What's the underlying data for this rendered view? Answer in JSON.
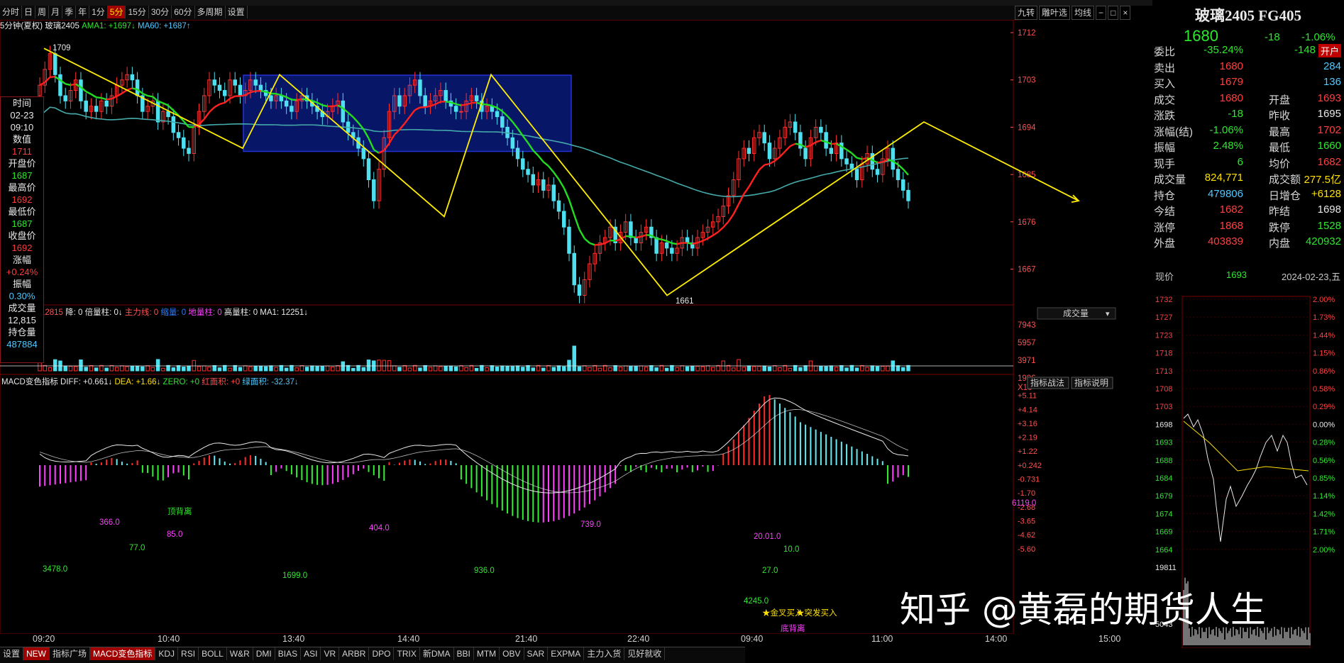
{
  "toolbar": {
    "periods": [
      "分时",
      "日",
      "周",
      "月",
      "季",
      "年",
      "1分",
      "5分",
      "15分",
      "30分",
      "60分",
      "多周期",
      "设置"
    ],
    "active_period": "5分",
    "right_buttons": [
      "九转",
      "雕叶选",
      "均线"
    ]
  },
  "chart_header": {
    "period": "5分钟(夏权)",
    "symbol": "玻璃2405",
    "ama1": "AMA1: +1697↓",
    "ma60": "MA60: +1687↑"
  },
  "cursor_box": {
    "items": [
      {
        "label": "时间",
        "value": "02-23"
      },
      {
        "label": "",
        "value": "09:10"
      },
      {
        "label": "数值",
        "value": "1711"
      },
      {
        "label": "开盘价",
        "value": "1687"
      },
      {
        "label": "最高价",
        "value": "1692"
      },
      {
        "label": "最低价",
        "value": "1687"
      },
      {
        "label": "收盘价",
        "value": "1692"
      },
      {
        "label": "涨幅",
        "value": "+0.24%"
      },
      {
        "label": "振幅",
        "value": "0.30%"
      },
      {
        "label": "成交量",
        "value": "12,815"
      },
      {
        "label": "持仓量",
        "value": "487884"
      }
    ]
  },
  "price_axis": [
    "1712",
    "1703",
    "1694",
    "1685",
    "1676",
    "1667"
  ],
  "annotations": {
    "high": "1709",
    "low": "1661"
  },
  "volume_header": {
    "text": "VOLUME: 12815",
    "items": [
      "降: 0",
      "倍量柱: 0↓",
      "主力线: 0",
      "缩量: 0",
      "地量柱: 0",
      "高量柱: 0",
      "MA1: 12251↓"
    ],
    "dropdown": "成交量"
  },
  "volume_axis": [
    "7943",
    "5957",
    "3971",
    "1986",
    "X10"
  ],
  "macd_header": {
    "name": "MACD变色指标",
    "diff": "DIFF: +0.661↓",
    "dea": "DEA: +1.66↓",
    "zero": "ZERO: +0",
    "red_area": "红面积: +0",
    "green_area": "绿面积: -32.37↓",
    "buttons": [
      "指标战法",
      "指标说明"
    ]
  },
  "macd_axis": [
    "+5.11",
    "+4.14",
    "+3.16",
    "+2.19",
    "+1.22",
    "+0.242",
    "-0.731",
    "-1.70",
    "-2.68",
    "-3.65",
    "-4.62",
    "-5.60"
  ],
  "macd_labels": [
    {
      "t": "顶背离"
    },
    {
      "t": "366.0"
    },
    {
      "t": "77.0"
    },
    {
      "t": "85.0"
    },
    {
      "t": "3478.0"
    },
    {
      "t": "1699.0"
    },
    {
      "t": "404.0"
    },
    {
      "t": "936.0"
    },
    {
      "t": "739.0"
    },
    {
      "t": "20.01.0"
    },
    {
      "t": "10.0"
    },
    {
      "t": "27.0"
    },
    {
      "t": "4245.0"
    },
    {
      "t": "★金叉买入"
    },
    {
      "t": "★突发买入"
    },
    {
      "t": "底背离"
    },
    {
      "t": "6119.0"
    }
  ],
  "time_axis": [
    "09:20",
    "10:40",
    "13:40",
    "14:40",
    "21:40",
    "22:40",
    "09:40",
    "11:00",
    "14:00",
    "15:00"
  ],
  "bottom_tabs": [
    "设置",
    "NEW",
    "指标广场",
    "MACD变色指标",
    "KDJ",
    "RSI",
    "BOLL",
    "W&R",
    "DMI",
    "BIAS",
    "ASI",
    "VR",
    "ARBR",
    "DPO",
    "TRIX",
    "新DMA",
    "BBI",
    "MTM",
    "OBV",
    "SAR",
    "EXPMA",
    "主力入货",
    "见好就收"
  ],
  "active_tab": "MACD变色指标",
  "right_panel": {
    "title": "玻璃2405 FG405",
    "price": "1680",
    "change": "-18",
    "change_pct": "-1.06%",
    "rows": [
      {
        "l": "委比",
        "v1": "-35.24%",
        "v2": "-148",
        "extra": "开户"
      },
      {
        "l": "卖出",
        "v1": "1680",
        "v2": "284"
      },
      {
        "l": "买入",
        "v1": "1679",
        "v2": "136"
      },
      {
        "l": "成交",
        "v1": "1680",
        "l2": "开盘",
        "v2": "1693"
      },
      {
        "l": "涨跌",
        "v1": "-18",
        "l2": "昨收",
        "v2": "1695"
      },
      {
        "l": "涨幅(结)",
        "v1": "-1.06%",
        "l2": "最高",
        "v2": "1702"
      },
      {
        "l": "振幅",
        "v1": "2.48%",
        "l2": "最低",
        "v2": "1660"
      },
      {
        "l": "现手",
        "v1": "6",
        "l2": "均价",
        "v2": "1682"
      },
      {
        "l": "成交量",
        "v1": "824,771",
        "l2": "成交额",
        "v2": "277.5亿"
      },
      {
        "l": "持仓",
        "v1": "479806",
        "l2": "日增仓",
        "v2": "+6128"
      },
      {
        "l": "今结",
        "v1": "1682",
        "l2": "昨结",
        "v2": "1698"
      },
      {
        "l": "涨停",
        "v1": "1868",
        "l2": "跌停",
        "v2": "1528"
      },
      {
        "l": "外盘",
        "v1": "403839",
        "l2": "内盘",
        "v2": "420932"
      }
    ],
    "now_label": "现价",
    "now_value": "1693",
    "date": "2024-02-23,五",
    "mini_axis_left": [
      "1732",
      "1727",
      "1723",
      "1718",
      "1713",
      "1708",
      "1703",
      "1698",
      "1693",
      "1688",
      "1684",
      "1679",
      "1674",
      "1669",
      "1664",
      "19811",
      "5043"
    ],
    "mini_axis_right": [
      "2.00%",
      "1.73%",
      "1.44%",
      "1.15%",
      "0.86%",
      "0.58%",
      "0.29%",
      "0.00%",
      "0.28%",
      "0.56%",
      "0.85%",
      "1.14%",
      "1.42%",
      "1.71%",
      "2.00%"
    ]
  },
  "watermark": "知乎 @黄磊的期货人生",
  "colors": {
    "up": "#ff3030",
    "down": "#4fe0f0",
    "ama": "#33dd33",
    "ma60": "#44aaaa",
    "zigzag": "#ffee00",
    "box": "#0a1a7a"
  }
}
